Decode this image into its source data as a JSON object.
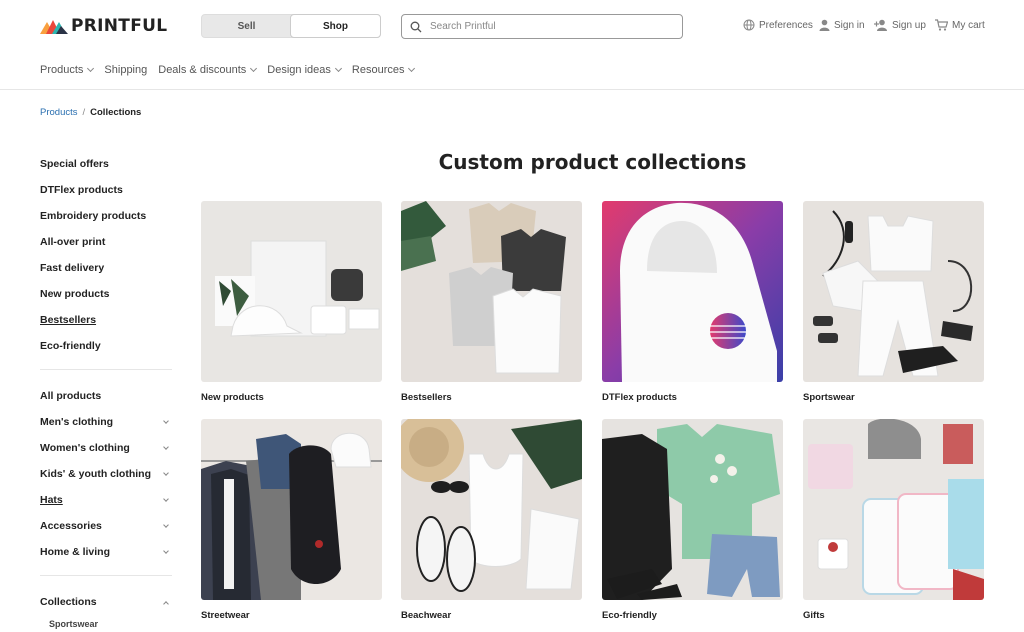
{
  "header": {
    "brand": "PRINTFUL",
    "toggle": {
      "sell": "Sell",
      "shop": "Shop"
    },
    "search_placeholder": "Search Printful",
    "preferences": "Preferences",
    "sign_in": "Sign in",
    "sign_up": "Sign up",
    "cart": "My cart"
  },
  "nav": [
    "Products",
    "Shipping",
    "Deals & discounts",
    "Design ideas",
    "Resources"
  ],
  "breadcrumb": {
    "parent": "Products",
    "separator": "/",
    "current": "Collections"
  },
  "sidebar": {
    "group1": [
      "Special offers",
      "DTFlex products",
      "Embroidery products",
      "All-over print",
      "Fast delivery",
      "New products",
      "Bestsellers",
      "Eco-friendly"
    ],
    "group2": [
      "All products",
      "Men's clothing",
      "Women's clothing",
      "Kids' & youth clothing",
      "Hats",
      "Accessories",
      "Home & living"
    ],
    "group3_title": "Collections",
    "group3_items": [
      "Sportswear"
    ]
  },
  "main": {
    "title": "Custom product collections",
    "cards": [
      "New products",
      "Bestsellers",
      "DTFlex products",
      "Sportswear",
      "Streetwear",
      "Beachwear",
      "Eco-friendly",
      "Gifts"
    ]
  },
  "colors": {
    "link": "#2a6fb0",
    "logo_orange": "#f26b3a",
    "logo_teal": "#2bb5b0",
    "logo_dark": "#2a3346"
  }
}
